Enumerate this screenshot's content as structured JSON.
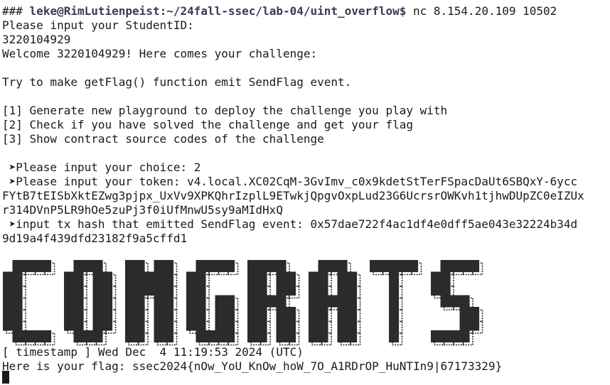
{
  "prompt": {
    "marker": "###",
    "user_host_path": "leke@RimLutienpeist:~/24fall-ssec/lab-04/uint_overflow$",
    "command": " nc 8.154.20.109 10502"
  },
  "lines": {
    "l1": "Please input your StudentID:",
    "l2": "3220104929",
    "l3": "Welcome 3220104929! Here comes your challenge:",
    "l4": "",
    "l5": "Try to make getFlag() function emit SendFlag event.",
    "l6": "",
    "l7": "[1] Generate new playground to deploy the challenge you play with",
    "l8": "[2] Check if you have solved the challenge and get your flag",
    "l9": "[3] Show contract source codes of the challenge",
    "l10": "",
    "l11": " ➤Please input your choice: 2",
    "l12": " ➤Please input your token: v4.local.XC02CqM-3GvImv_c0x9kdetStTerFSpacDaUt6SBQxY-6ycc",
    "l13": "FYtB7tEISbXktEZwg3pjpx_UxVv9XPKQhrIzplL9ETwkjQpgvOxpLud23G6UcrsrOWKvh1tjhwDUpZC0eIZUx",
    "l14": "r314DVnP5LR9hOe5zuPj3f0iUfMnwU5sy9aMIdHxQ",
    "l15": " ➤input tx hash that emitted SendFlag event: 0x57dae722f4ac1df4e0dff5ae043e32224b34d",
    "l16": "9d19a4f439dfd23182f9a5cffd1",
    "l24": "[ timestamp ] Wed Dec  4 11:19:53 2024 (UTC)",
    "l25": "Here is your flag: ssec2024{nOw_YoU_KnOw_hoW_7O_A1RDrOP_HuNTIn9|67173329}"
  },
  "banner": {
    "text": "CONGRATS",
    "fill_color": "#2b2b2b",
    "outline_color": "#2b2b2b"
  },
  "colors": {
    "background": "#ffffff",
    "foreground": "#1a1a1a"
  }
}
